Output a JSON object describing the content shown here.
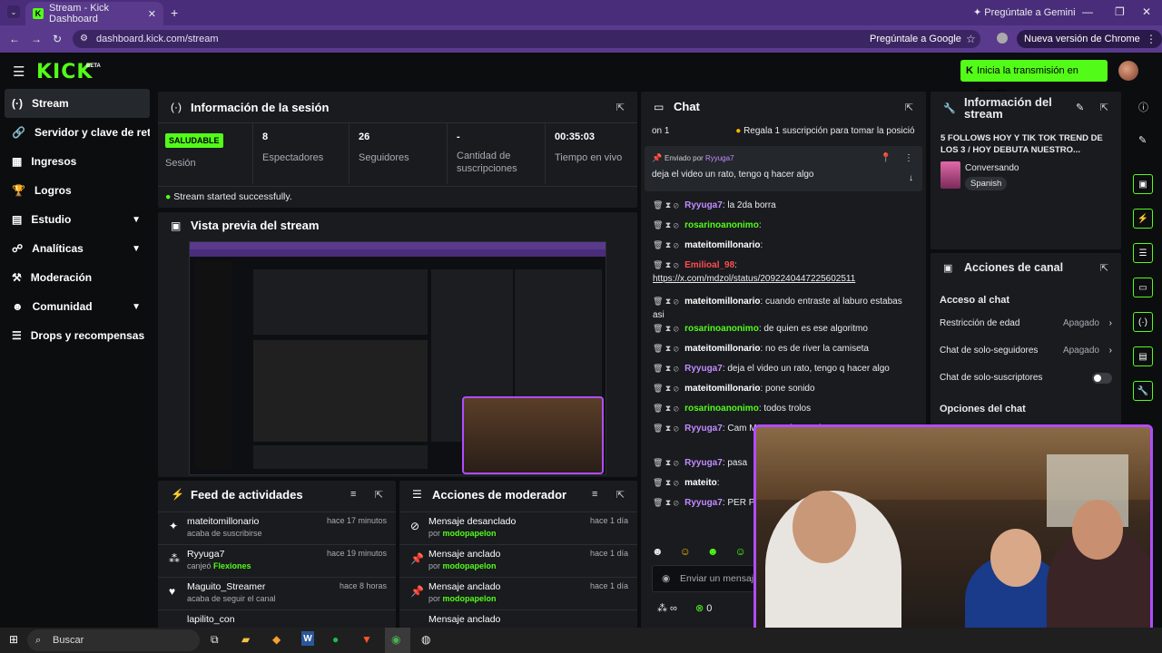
{
  "browser": {
    "tab_title": "Stream - Kick Dashboard",
    "url": "dashboard.kick.com/stream",
    "gemini_label": "Pregúntale a Gemini",
    "google_label": "Pregúntale a Google",
    "chrome_update": "Nueva versión de Chrome disponible"
  },
  "header": {
    "logo": "KICK",
    "beta": "BETA",
    "go_live": "Inicia la transmisión en directo"
  },
  "sidebar": {
    "items": [
      {
        "label": "Stream",
        "icon": "stream-icon"
      },
      {
        "label": "Servidor y clave de retransmisión",
        "icon": "link-icon"
      },
      {
        "label": "Ingresos",
        "icon": "chart-icon"
      },
      {
        "label": "Logros",
        "icon": "trophy-icon"
      },
      {
        "label": "Estudio",
        "icon": "grid-icon"
      },
      {
        "label": "Analíticas",
        "icon": "analytics-icon"
      },
      {
        "label": "Moderación",
        "icon": "hammer-icon"
      },
      {
        "label": "Comunidad",
        "icon": "community-icon"
      },
      {
        "label": "Drops y recompensas",
        "icon": "drops-icon"
      }
    ]
  },
  "session": {
    "title": "Información de la sesión",
    "status": "SALUDABLE",
    "status_label": "Sesión",
    "viewers": "8",
    "viewers_label": "Espectadores",
    "followers": "26",
    "followers_label": "Seguidores",
    "subs": "-",
    "subs_label": "Cantidad de suscripciones",
    "live_time": "00:35:03",
    "live_time_label": "Tiempo en vivo",
    "started": "Stream started successfully."
  },
  "preview": {
    "title": "Vista previa del stream"
  },
  "activity": {
    "title": "Feed de actividades",
    "rows": [
      {
        "name": "mateitomillonario",
        "sub": "acaba de suscribirse",
        "time": "hace 17 minutos"
      },
      {
        "name": "Ryyuga7",
        "sub": "canjeó",
        "reward": "Flexiones",
        "time": "hace 19 minutos"
      },
      {
        "name": "Maguito_Streamer",
        "sub": "acaba de seguir el canal",
        "time": "hace 8 horas"
      },
      {
        "name": "lapilito_con",
        "sub": "",
        "time": ""
      }
    ]
  },
  "modactions": {
    "title": "Acciones de moderador",
    "rows": [
      {
        "name": "Mensaje desanclado",
        "by": "por",
        "mod": "modopapelon",
        "time": "hace 1 día"
      },
      {
        "name": "Mensaje anclado",
        "by": "por",
        "mod": "modopapelon",
        "time": "hace 1 día"
      },
      {
        "name": "Mensaje anclado",
        "by": "por",
        "mod": "modopapelon",
        "time": "hace 1 día"
      },
      {
        "name": "Mensaje anclado",
        "by": "",
        "mod": "",
        "time": ""
      }
    ]
  },
  "chat": {
    "title": "Chat",
    "gift_banner": "Regala 1 suscripción para tomar la posició",
    "gift_prefix": "on 1",
    "pinned_by_label": "Enviado por",
    "pinned_user": "Ryyuga7",
    "pinned_text": "deja el video un rato, tengo q hacer algo",
    "messages": [
      {
        "user": "Ryyuga7",
        "color": "#c28cff",
        "text": "la 2da borra"
      },
      {
        "user": "rosarinoanonimo",
        "color": "#53fc18",
        "text": ""
      },
      {
        "user": "mateitomillonario",
        "color": "#ffffff",
        "text": ""
      },
      {
        "user": "Emilioal_98",
        "color": "#ff4d4d",
        "text": "https://x.com/mdzol/status/2092240447225602511"
      },
      {
        "user": "mateitomillonario",
        "color": "#ffffff",
        "text": "cuando entraste al laburo estabas asi"
      },
      {
        "user": "rosarinoanonimo",
        "color": "#53fc18",
        "text": "de quien es ese algoritmo"
      },
      {
        "user": "mateitomillonario",
        "color": "#ffffff",
        "text": "no es de river la camiseta"
      },
      {
        "user": "Ryyuga7",
        "color": "#c28cff",
        "text": "deja el video un rato, tengo q hacer algo"
      },
      {
        "user": "mateitomillonario",
        "color": "#ffffff",
        "text": "pone sonido"
      },
      {
        "user": "rosarinoanonimo",
        "color": "#53fc18",
        "text": "todos trolos"
      },
      {
        "user": "Ryyuga7",
        "color": "#c28cff",
        "text": "Cam Maure, aplauso al campe"
      },
      {
        "user": "Ryyuga7",
        "color": "#c28cff",
        "text": "pasa"
      },
      {
        "user": "mateito",
        "color": "#ffffff",
        "text": ""
      },
      {
        "user": "Ryyuga7",
        "color": "#c28cff",
        "text": "PER POSTA"
      }
    ],
    "input_placeholder": "Enviar un mensaje",
    "points": "0"
  },
  "stream_info": {
    "title": "Información del stream",
    "stream_title": "5 FOLLOWS HOY Y TIK TOK TREND DE LOS 3 / HOY DEBUTA NUESTRO...",
    "category": "Conversando",
    "language": "Spanish"
  },
  "channel_actions": {
    "title": "Acciones de canal",
    "chat_access": "Acceso al chat",
    "age_restriction": "Restricción de edad",
    "age_value": "Apagado",
    "followers_only": "Chat de solo-seguidores",
    "followers_value": "Apagado",
    "subs_only": "Chat de solo-suscriptores",
    "chat_options": "Opciones del chat"
  },
  "taskbar": {
    "search": "Buscar"
  }
}
